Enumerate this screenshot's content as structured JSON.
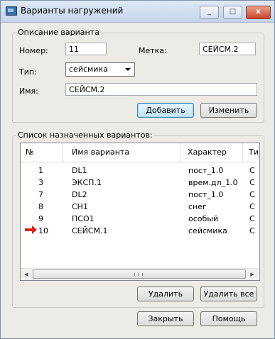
{
  "window": {
    "title": "Варианты нагружений",
    "minimize": "_",
    "maximize": "□",
    "close": "x"
  },
  "description": {
    "group_label": "Описание варианта",
    "number_label": "Номер:",
    "number_value": "11",
    "tag_label": "Метка:",
    "tag_value": "СЕЙСМ.2",
    "type_label": "Тип:",
    "type_value": "сейсмика",
    "name_label": "Имя:",
    "name_value": "СЕЙСМ.2",
    "add_button": "Добавить",
    "change_button": "Изменить"
  },
  "assigned": {
    "group_label": "Список назначенных вариантов:",
    "columns": [
      "№",
      "Имя варианта",
      "Характер",
      "Ти"
    ],
    "rows": [
      {
        "num": "1",
        "name": "DL1",
        "character": "пост_1.0",
        "type": "С"
      },
      {
        "num": "3",
        "name": "ЭКСП.1",
        "character": "врем.дл_1.0",
        "type": "С"
      },
      {
        "num": "7",
        "name": "DL2",
        "character": "пост_1.0",
        "type": "С"
      },
      {
        "num": "8",
        "name": "СН1",
        "character": "снег",
        "type": "С"
      },
      {
        "num": "9",
        "name": "ПСО1",
        "character": "особый",
        "type": "С"
      },
      {
        "num": "10",
        "name": "СЕЙСМ.1",
        "character": "сейсмика",
        "type": "С"
      }
    ],
    "current_row_marker": "red-right-arrow-icon",
    "delete_button": "Удалить",
    "delete_all_button": "Удалить все"
  },
  "footer": {
    "close_button": "Закрыть",
    "help_button": "Помощь"
  },
  "colors": {
    "marker": "#e0201a",
    "default_button": "#bee6fd"
  }
}
